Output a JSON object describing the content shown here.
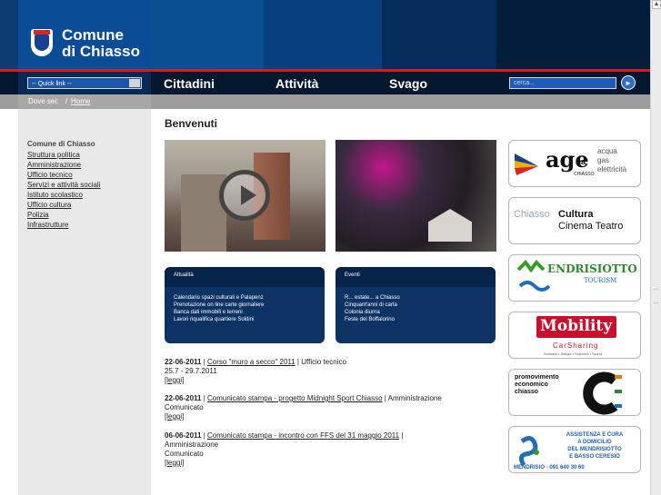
{
  "header": {
    "logo_line1": "Comune",
    "logo_line2": "di Chiasso",
    "quick_link": "-- Quick link --",
    "nav": [
      "Cittadini",
      "Attività",
      "Svago"
    ],
    "search_placeholder": "cerca..."
  },
  "breadcrumb": {
    "label": "Dove sei:",
    "separator": "/",
    "home": "Home"
  },
  "sidebar": {
    "title": "Comune di Chiasso",
    "items": [
      "Struttura politica",
      "Amministrazione",
      "Ufficio tecnico",
      "Servizi e attività sociali",
      "Istituto scolastico",
      "Ufficio cultura",
      "Polizia",
      "Infrastrutture"
    ]
  },
  "main": {
    "title": "Benvenuti",
    "boxes": [
      {
        "title": "Attualità",
        "items": [
          "Calendario spazi culturali e Palapenz",
          "Prenotazione on line carte giornaliere",
          "Banca dati immobili e terreni",
          "Lavori riqualifica quartiere Soldini"
        ]
      },
      {
        "title": "Eventi",
        "items": [
          "R... estate... a Chiasso",
          "Cinquant'anni di carta",
          "Colonia diurna",
          "Feste del Boffalorino"
        ]
      }
    ],
    "news": [
      {
        "date": "22-06-2011",
        "link": "Corso \"muro a secco\" 2011",
        "office": "Ufficio tecnico",
        "extra": "25.7 - 29.7.2011",
        "read": "[leggi]"
      },
      {
        "date": "22-06-2011",
        "link": "Comunicato stampa - progetto Midnight Sport Chiasso",
        "office": "Amministrazione",
        "extra": "Comunicato",
        "read": "[leggi]"
      },
      {
        "date": "06-06-2011",
        "link": "Comunicato stampa - incontro con FFS del 31 maggio 2011",
        "office": "Amministrazione",
        "extra": "Comunicato",
        "read": "[leggi]"
      }
    ]
  },
  "ads": {
    "age": {
      "brand": "age",
      "suffix": "sa",
      "sub": "CHIASSO",
      "l1": "acqua",
      "l2": "gas",
      "l3": "elettricità"
    },
    "cultura": {
      "a": "Chiasso",
      "b": "Cultura",
      "c": "Cinema Teatro"
    },
    "mendrisiotto": {
      "a": "ENDRISIOTTO",
      "b": "TOURISM"
    },
    "mobility": {
      "a": "Mobility",
      "b": "CarSharing",
      "c": "Schweiz • Suisse • Svizzera • Svizra"
    },
    "promo": {
      "l1": "promovimento",
      "l2": "economico",
      "l3": "chiasso"
    },
    "assistenza": {
      "l1": "ASSISTENZA E CURA",
      "l2": "A DOMICILIO",
      "l3": "DEL MENDRISIOTTO",
      "l4": "E BASSO CERESIO",
      "l5": "MENDRISIO - 091 640 30 60"
    }
  },
  "colors": {
    "header_blue": "#0a4d96",
    "red_line": "#d41c1c",
    "box_navy": "#0d3264"
  }
}
